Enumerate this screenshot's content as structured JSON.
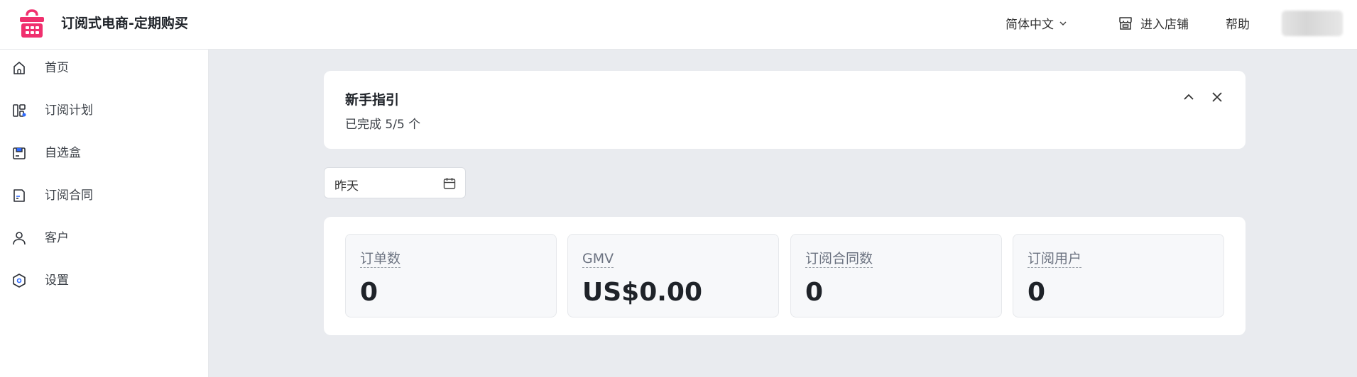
{
  "header": {
    "app_title": "订阅式电商-定期购买",
    "language": "简体中文",
    "enter_store": "进入店铺",
    "help": "帮助",
    "brand_color": "#f0306e"
  },
  "sidebar": {
    "items": [
      {
        "label": "首页",
        "icon": "home-icon"
      },
      {
        "label": "订阅计划",
        "icon": "plan-icon"
      },
      {
        "label": "自选盒",
        "icon": "box-icon"
      },
      {
        "label": "订阅合同",
        "icon": "contract-icon"
      },
      {
        "label": "客户",
        "icon": "user-icon"
      },
      {
        "label": "设置",
        "icon": "settings-icon"
      }
    ]
  },
  "guide": {
    "title": "新手指引",
    "progress_text": "已完成 5/5 个"
  },
  "date_filter": {
    "value": "昨天"
  },
  "stats": [
    {
      "label": "订单数",
      "value": "0"
    },
    {
      "label": "GMV",
      "value": "US$0.00"
    },
    {
      "label": "订阅合同数",
      "value": "0"
    },
    {
      "label": "订阅用户",
      "value": "0"
    }
  ]
}
